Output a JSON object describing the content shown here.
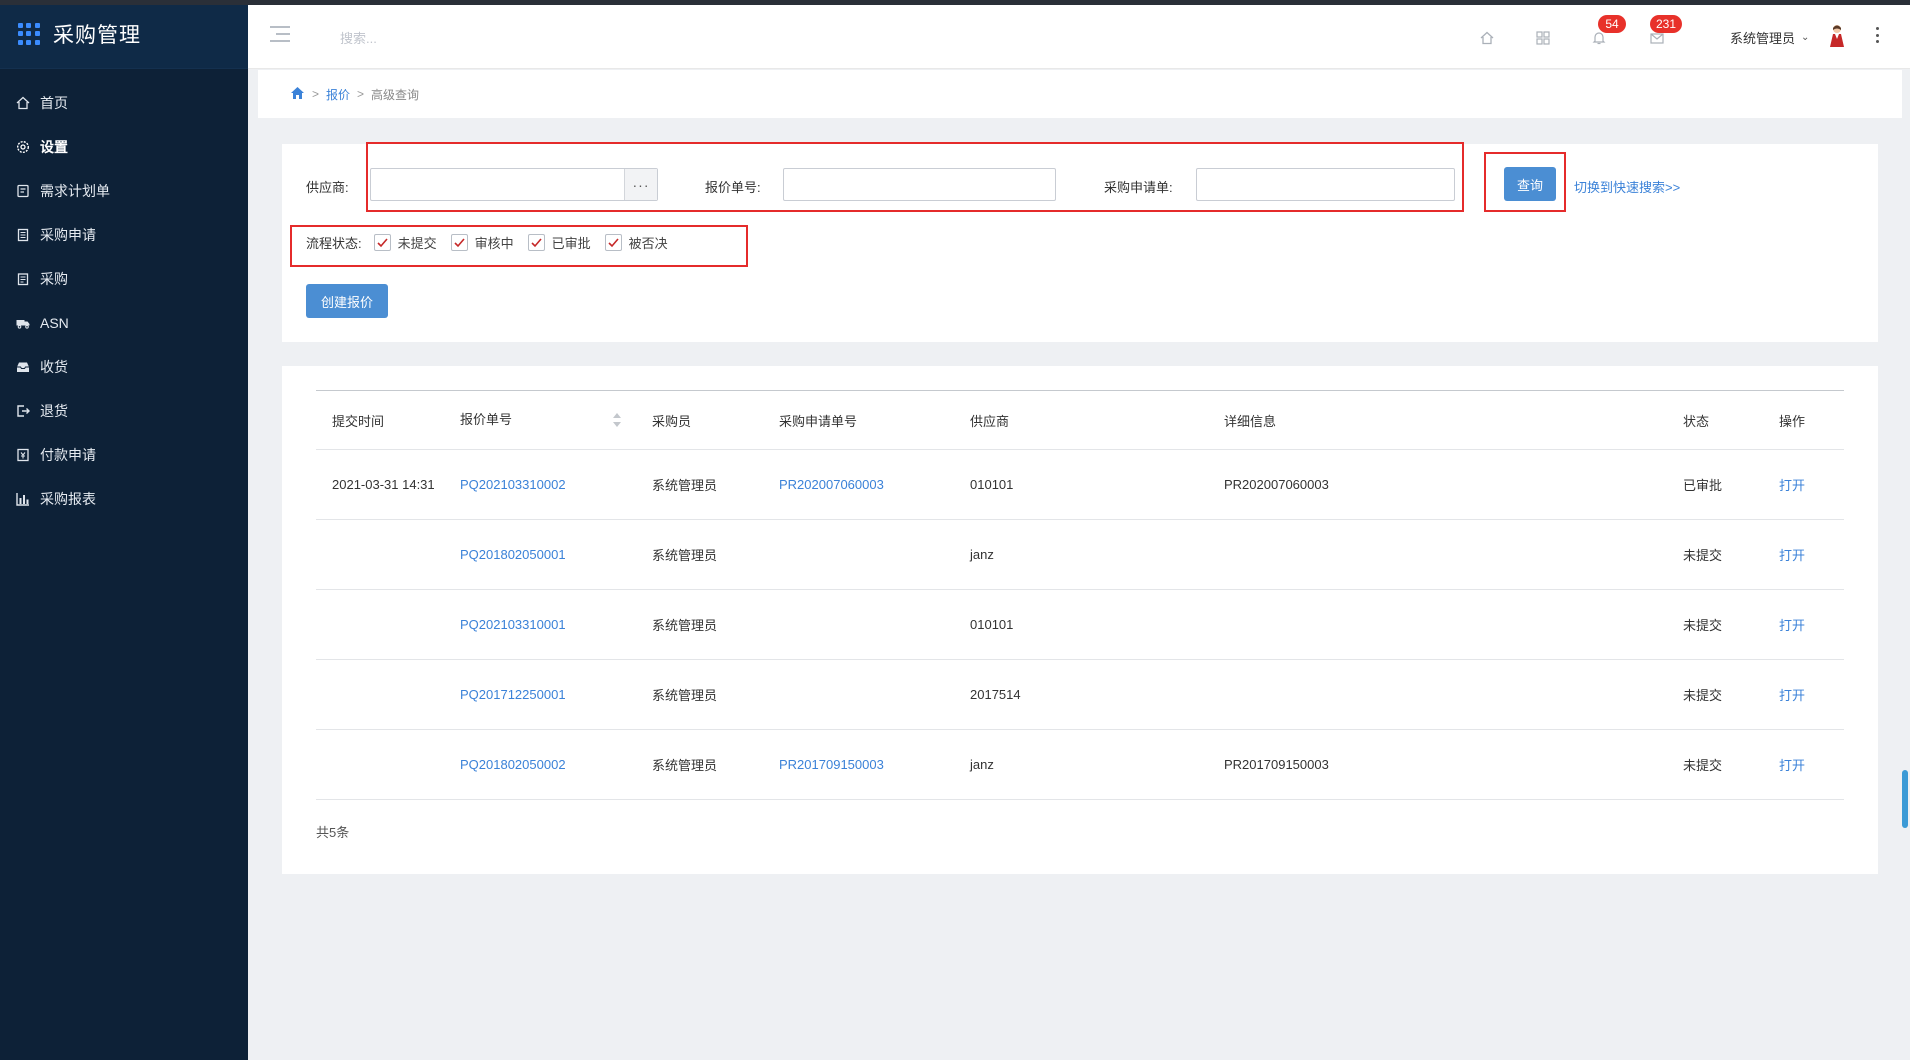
{
  "app": {
    "title": "采购管理"
  },
  "sidebar": {
    "items": [
      {
        "label": "首页",
        "icon": "home-icon"
      },
      {
        "label": "设置",
        "icon": "gear-icon"
      },
      {
        "label": "需求计划单",
        "icon": "document-icon"
      },
      {
        "label": "采购申请",
        "icon": "form-icon"
      },
      {
        "label": "采购",
        "icon": "clipboard-icon"
      },
      {
        "label": "ASN",
        "icon": "truck-icon"
      },
      {
        "label": "收货",
        "icon": "inbox-icon"
      },
      {
        "label": "退货",
        "icon": "return-icon"
      },
      {
        "label": "付款申请",
        "icon": "payment-icon"
      },
      {
        "label": "采购报表",
        "icon": "bar-chart-icon"
      }
    ]
  },
  "header": {
    "search_placeholder": "搜索...",
    "notifications_count": "54",
    "messages_count": "231",
    "user_name": "系统管理员"
  },
  "breadcrumb": {
    "parent": "报价",
    "current": "高级查询"
  },
  "filters": {
    "supplier_label": "供应商:",
    "supplier_value": "",
    "picker_label": "···",
    "quote_no_label": "报价单号:",
    "quote_no_value": "",
    "pr_no_label": "采购申请单:",
    "pr_no_value": "",
    "query_button": "查询",
    "toggle_link": "切换到快速搜索>>",
    "status_label": "流程状态:",
    "statuses": [
      {
        "label": "未提交",
        "checked": true
      },
      {
        "label": "审核中",
        "checked": true
      },
      {
        "label": "已审批",
        "checked": true
      },
      {
        "label": "被否决",
        "checked": true
      }
    ],
    "create_button": "创建报价"
  },
  "table": {
    "columns": [
      "提交时间",
      "报价单号",
      "采购员",
      "采购申请单号",
      "供应商",
      "详细信息",
      "状态",
      "操作"
    ],
    "rows": [
      {
        "submit_time": "2021-03-31 14:31",
        "quote_no": "PQ202103310002",
        "buyer": "系统管理员",
        "pr_no": "PR202007060003",
        "supplier": "010101",
        "detail": "PR202007060003",
        "status": "已审批",
        "action": "打开"
      },
      {
        "submit_time": "",
        "quote_no": "PQ201802050001",
        "buyer": "系统管理员",
        "pr_no": "",
        "supplier": "janz",
        "detail": "",
        "status": "未提交",
        "action": "打开"
      },
      {
        "submit_time": "",
        "quote_no": "PQ202103310001",
        "buyer": "系统管理员",
        "pr_no": "",
        "supplier": "010101",
        "detail": "",
        "status": "未提交",
        "action": "打开"
      },
      {
        "submit_time": "",
        "quote_no": "PQ201712250001",
        "buyer": "系统管理员",
        "pr_no": "",
        "supplier": "2017514",
        "detail": "",
        "status": "未提交",
        "action": "打开"
      },
      {
        "submit_time": "",
        "quote_no": "PQ201802050002",
        "buyer": "系统管理员",
        "pr_no": "PR201709150003",
        "supplier": "janz",
        "detail": "PR201709150003",
        "status": "未提交",
        "action": "打开"
      }
    ],
    "total": "共5条"
  },
  "colors": {
    "accent": "#3b82d8",
    "sidebar": "#0d2137",
    "badge": "#e8312a",
    "highlight": "#e52b2b"
  }
}
